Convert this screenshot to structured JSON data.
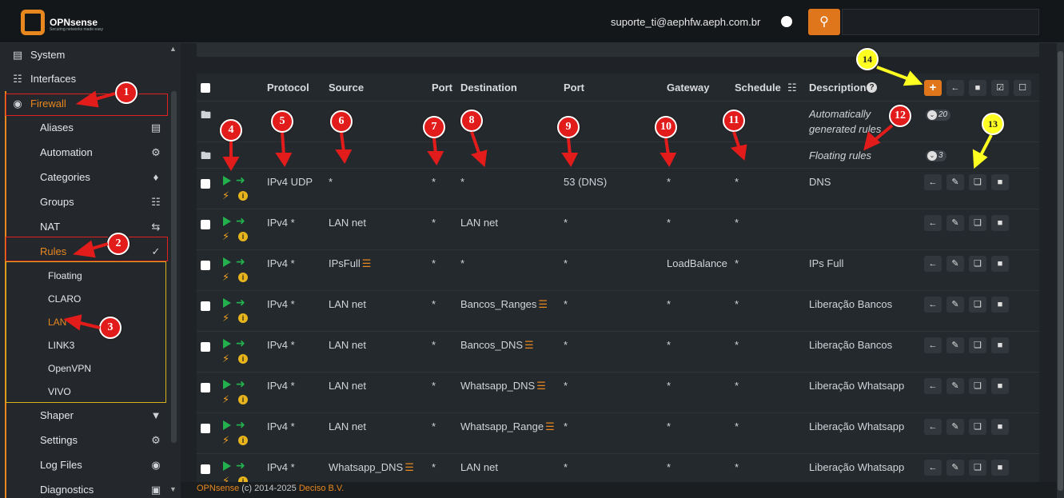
{
  "brand": {
    "name": "OPNsense",
    "tagline": "Securing networks made easy"
  },
  "header": {
    "user": "suporte_ti@aephfw.aeph.com.br",
    "search_placeholder": ""
  },
  "sidebar": {
    "system": "System",
    "interfaces": "Interfaces",
    "firewall": "Firewall",
    "items": [
      "Aliases",
      "Automation",
      "Categories",
      "Groups",
      "NAT",
      "Rules"
    ],
    "rules_sub": [
      "Floating",
      "CLARO",
      "LAN",
      "LINK3",
      "OpenVPN",
      "VIVO"
    ],
    "items_after": [
      "Shaper",
      "Settings",
      "Log Files",
      "Diagnostics"
    ]
  },
  "table": {
    "headers": {
      "protocol": "Protocol",
      "source": "Source",
      "sport": "Port",
      "destination": "Destination",
      "dport": "Port",
      "gateway": "Gateway",
      "schedule": "Schedule",
      "description": "Description"
    },
    "groups": [
      {
        "desc1": "Automatically",
        "desc2": "generated rules",
        "count": "20"
      },
      {
        "desc1": "Floating rules",
        "count": "3"
      }
    ],
    "rows": [
      {
        "protocol": "IPv4 UDP",
        "source": "*",
        "sport": "*",
        "destination": "*",
        "dport": "53 (DNS)",
        "gateway": "*",
        "schedule": "*",
        "description": "DNS",
        "src_alias": false,
        "dst_alias": false
      },
      {
        "protocol": "IPv4 *",
        "source": "LAN net",
        "sport": "*",
        "destination": "LAN net",
        "dport": "*",
        "gateway": "*",
        "schedule": "*",
        "description": "",
        "src_alias": false,
        "dst_alias": false
      },
      {
        "protocol": "IPv4 *",
        "source": "IPsFull",
        "sport": "*",
        "destination": "*",
        "dport": "*",
        "gateway": "LoadBalance",
        "schedule": "*",
        "description": "IPs Full",
        "src_alias": true,
        "dst_alias": false
      },
      {
        "protocol": "IPv4 *",
        "source": "LAN net",
        "sport": "*",
        "destination": "Bancos_Ranges",
        "dport": "*",
        "gateway": "*",
        "schedule": "*",
        "description": "Liberação Bancos",
        "src_alias": false,
        "dst_alias": true
      },
      {
        "protocol": "IPv4 *",
        "source": "LAN net",
        "sport": "*",
        "destination": "Bancos_DNS",
        "dport": "*",
        "gateway": "*",
        "schedule": "*",
        "description": "Liberação Bancos",
        "src_alias": false,
        "dst_alias": true
      },
      {
        "protocol": "IPv4 *",
        "source": "LAN net",
        "sport": "*",
        "destination": "Whatsapp_DNS",
        "dport": "*",
        "gateway": "*",
        "schedule": "*",
        "description": "Liberação Whatsapp",
        "src_alias": false,
        "dst_alias": true
      },
      {
        "protocol": "IPv4 *",
        "source": "LAN net",
        "sport": "*",
        "destination": "Whatsapp_Range",
        "dport": "*",
        "gateway": "*",
        "schedule": "*",
        "description": "Liberação Whatsapp",
        "src_alias": false,
        "dst_alias": true
      },
      {
        "protocol": "IPv4 *",
        "source": "Whatsapp_DNS",
        "sport": "*",
        "destination": "LAN net",
        "dport": "*",
        "gateway": "*",
        "schedule": "*",
        "description": "Liberação Whatsapp",
        "src_alias": true,
        "dst_alias": false
      }
    ]
  },
  "annotations": [
    "1",
    "2",
    "3",
    "4",
    "5",
    "6",
    "7",
    "8",
    "9",
    "10",
    "11",
    "12",
    "13",
    "14"
  ],
  "footer": {
    "brand": "OPNsense",
    "copy": " (c) 2014-2025 ",
    "vendor": "Deciso B.V."
  },
  "colors": {
    "accent": "#e8871e",
    "annotation_red": "#e21b1b",
    "annotation_yellow": "#ffff22",
    "pass_green": "#22b14c"
  }
}
